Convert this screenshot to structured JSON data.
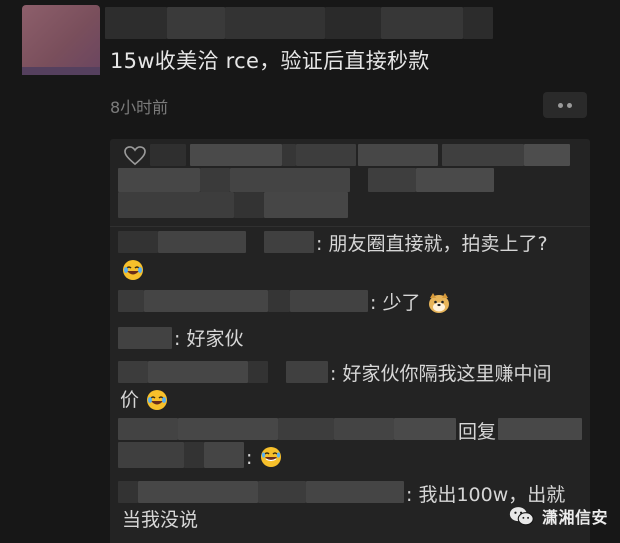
{
  "post": {
    "text": "15w收美洽 rce，验证后直接秒款",
    "time": "8小时前"
  },
  "comments": [
    {
      "text_1": ": 朋友圈直接就，拍卖上了?",
      "emoji": "laugh-cry-emoji"
    },
    {
      "text_1": ": 少了",
      "emoji": "doge-emoji"
    },
    {
      "text_1": ": 好家伙"
    },
    {
      "text_1": ": 好家伙你隔我这里赚中间",
      "text_2": "价",
      "emoji": "laugh-cry-emoji"
    },
    {
      "reply_label": "回复",
      "text_2": ":",
      "emoji": "tears-of-joy-emoji"
    },
    {
      "text_1": ": 我出100w，出就",
      "text_2": "当我没说"
    }
  ],
  "watermark": {
    "text": "潇湘信安",
    "icon": "wechat-channel-icon"
  },
  "colors": {
    "background": "#171717",
    "comment_box": "#232323",
    "text": "#d6d6d6",
    "muted": "#7c7c7c"
  }
}
